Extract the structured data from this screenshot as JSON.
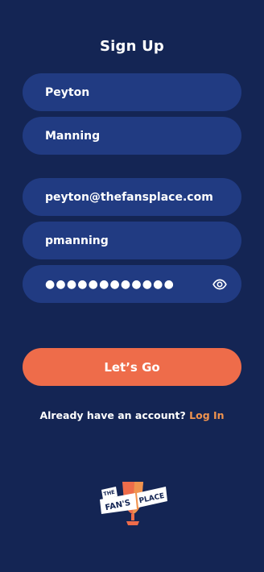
{
  "header": {
    "title": "Sign Up"
  },
  "form": {
    "first_name": "Peyton",
    "last_name": "Manning",
    "email": "peyton@thefansplace.com",
    "username": "pmanning",
    "password_masked": "●●●●●●●●●●●●"
  },
  "icons": {
    "password_toggle": "eye-icon"
  },
  "actions": {
    "submit_label": "Let’s Go"
  },
  "footer": {
    "prompt": "Already have an account? ",
    "login_link": "Log In"
  },
  "logo": {
    "line1": "THE",
    "line2": "FAN'S",
    "line3": "PLACE"
  },
  "colors": {
    "background": "#142554",
    "field": "#213b82",
    "accent": "#ee6c4a",
    "link": "#f0934e"
  }
}
